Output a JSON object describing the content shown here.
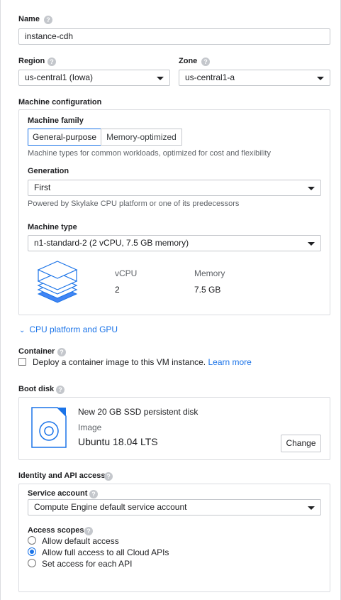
{
  "name": {
    "label": "Name",
    "value": "instance-cdh"
  },
  "region": {
    "label": "Region",
    "value": "us-central1 (Iowa)"
  },
  "zone": {
    "label": "Zone",
    "value": "us-central1-a"
  },
  "machine_configuration": {
    "title": "Machine configuration",
    "family_label": "Machine family",
    "tabs": [
      "General-purpose",
      "Memory-optimized"
    ],
    "family_description": "Machine types for common workloads, optimized for cost and flexibility",
    "generation_label": "Generation",
    "generation_value": "First",
    "generation_description": "Powered by Skylake CPU platform or one of its predecessors",
    "machine_type_label": "Machine type",
    "machine_type_value": "n1-standard-2 (2 vCPU, 7.5 GB memory)",
    "vcpu_label": "vCPU",
    "vcpu_value": "2",
    "memory_label": "Memory",
    "memory_value": "7.5 GB"
  },
  "cpu_platform_link": "CPU platform and GPU",
  "container": {
    "title": "Container",
    "checkbox_label": "Deploy a container image to this VM instance.",
    "learn_more": "Learn more"
  },
  "boot_disk": {
    "title": "Boot disk",
    "disk_title": "New 20 GB SSD persistent disk",
    "image_label": "Image",
    "image_value": "Ubuntu 18.04 LTS",
    "change_button": "Change"
  },
  "identity": {
    "title": "Identity and API access",
    "service_account_label": "Service account",
    "service_account_value": "Compute Engine default service account",
    "access_scopes_label": "Access scopes",
    "scopes": [
      "Allow default access",
      "Allow full access to all Cloud APIs",
      "Set access for each API"
    ],
    "selected_scope_index": 1
  },
  "colors": {
    "accent": "#1a73e8",
    "border": "#dadce0",
    "text": "#202124",
    "muted": "#5f6368"
  },
  "help_glyph": "?"
}
